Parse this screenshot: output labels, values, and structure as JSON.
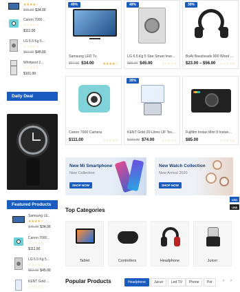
{
  "sidebar_top_items": [
    {
      "name": "",
      "price_old": "$45.00",
      "price": "$34.00"
    },
    {
      "name": "Canon 7000...",
      "price_old": "",
      "price": "$111.00"
    },
    {
      "name": "LG 6.5 Kg 5...",
      "price_old": "$52.00",
      "price": "$45.00"
    },
    {
      "name": "Whirlpool 2...",
      "price_old": "",
      "price": "$101.00"
    }
  ],
  "daily_deal": {
    "title": "Daily Deal"
  },
  "featured": {
    "title": "Featured Products",
    "items": [
      {
        "name": "Samsung LE...",
        "price_old": "$45.00",
        "price": "$34.00"
      },
      {
        "name": "Canon 7000...",
        "price_old": "",
        "price": "$111.00"
      },
      {
        "name": "LG 6.5 Kg 5...",
        "price_old": "$52.00",
        "price": "$45.00"
      },
      {
        "name": "KENT Gold ...",
        "price_old": "",
        "price": ""
      }
    ]
  },
  "products_row1": [
    {
      "badge": "49%",
      "name": "Samsung LED Tv",
      "price_old": "$67.00",
      "price": "$34.00",
      "stars": "★★★★☆"
    },
    {
      "badge": "49%",
      "name": "LG 6.5 Kg 5 Star Smart Inve...",
      "price_old": "$88.00",
      "price": "$45.00",
      "stars": "☆☆☆☆☆"
    },
    {
      "badge": "39%",
      "name": "BoAt Bassheads 900 Wired ...",
      "price_old": "",
      "price": "$23.00 – $56.00",
      "stars": "☆☆☆☆☆"
    }
  ],
  "products_row2": [
    {
      "badge": "",
      "name": "Canon 7000 Camera",
      "price_old": "",
      "price": "$111.00",
      "stars": "☆☆☆☆☆"
    },
    {
      "badge": "26%",
      "name": "KENT Gold 20-Litres UF Tec...",
      "price_old": "$100.00",
      "price": "$74.00",
      "stars": "☆☆☆☆☆"
    },
    {
      "badge": "",
      "name": "Fujifilm Instax Mini 9 Instan...",
      "price_old": "",
      "price": "$85.00",
      "stars": "☆☆☆☆☆"
    }
  ],
  "banners": [
    {
      "title": "New Mi Smartphone",
      "subtitle": "New Collection",
      "button": "SHOP NOW"
    },
    {
      "title": "New Watch Collection",
      "subtitle": "New Arrival 2020",
      "button": "SHOP NOW"
    }
  ],
  "top_categories": {
    "title": "Top Categories",
    "items": [
      "Tablet",
      "Controllers",
      "Headphone",
      "Juicer"
    ]
  },
  "popular": {
    "title": "Popular Products",
    "tabs": [
      "Headphone",
      "Juicer",
      "Led TV",
      "Phone",
      "Pot"
    ],
    "prev": "‹",
    "next": "›"
  },
  "side_tags": [
    "USD",
    "US$"
  ],
  "colors": {
    "accent": "#1a5bbf",
    "star": "#f5a623"
  }
}
